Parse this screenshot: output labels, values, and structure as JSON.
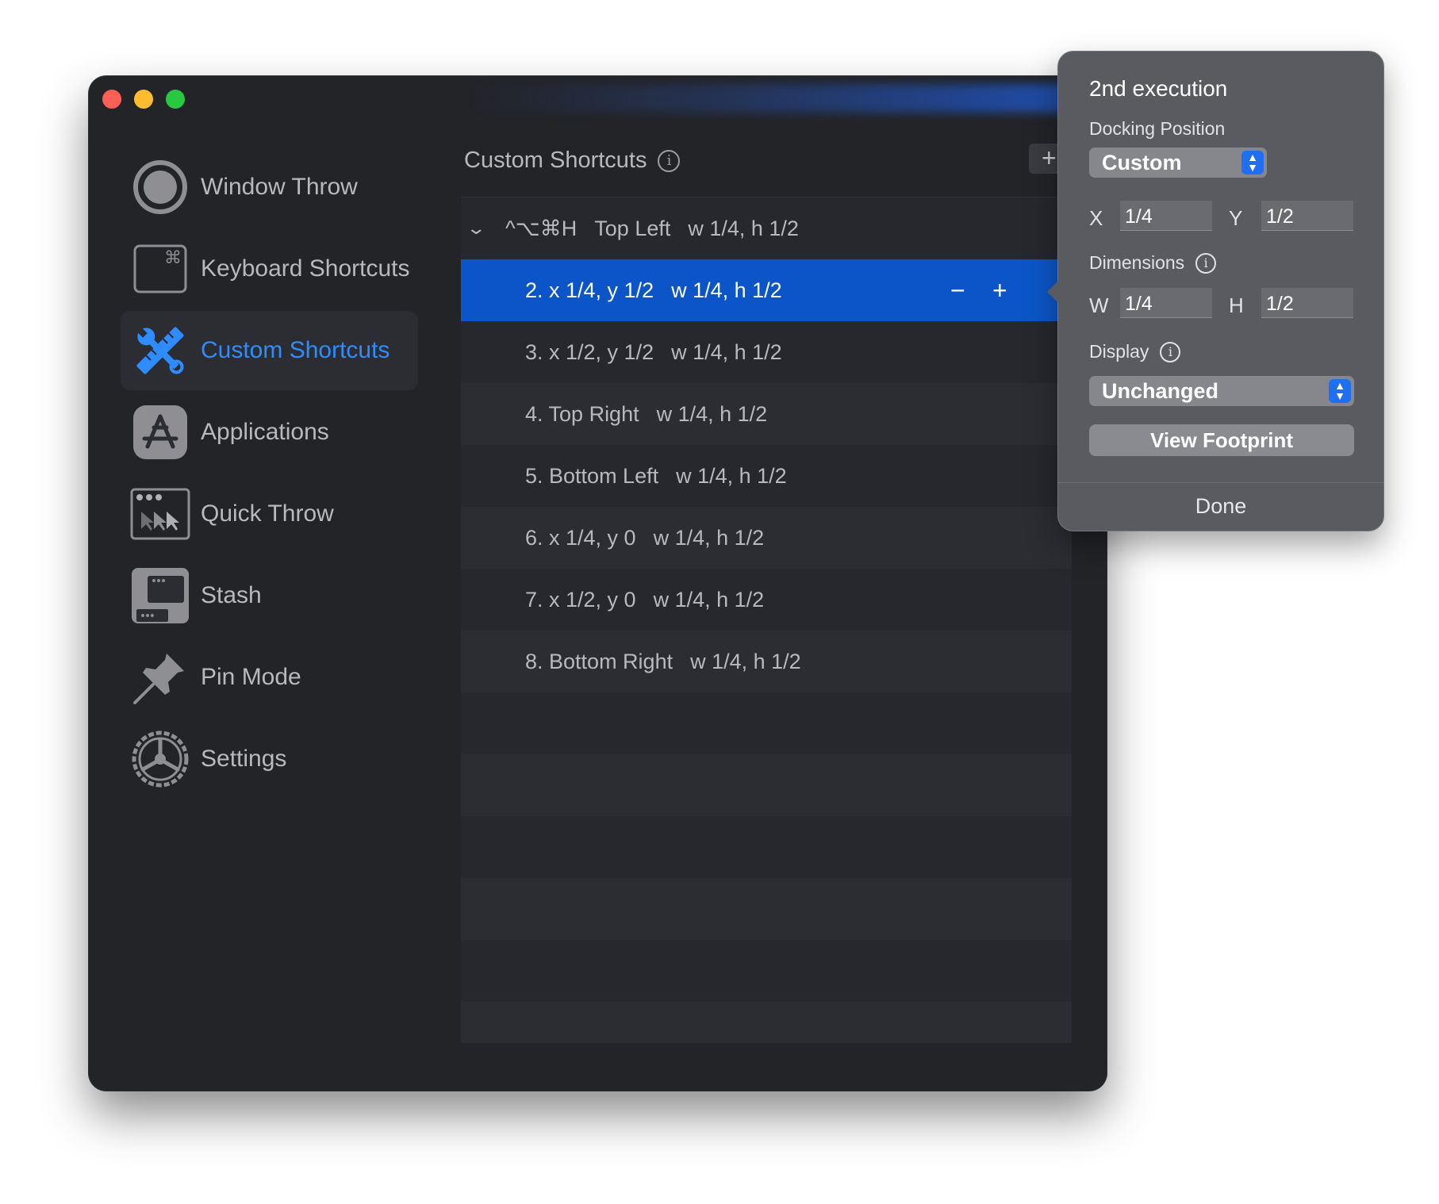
{
  "sidebar": {
    "items": [
      {
        "label": "Window Throw",
        "icon": "window-throw-icon"
      },
      {
        "label": "Keyboard Shortcuts",
        "icon": "command-key-icon"
      },
      {
        "label": "Custom Shortcuts",
        "icon": "wrench-ruler-icon",
        "active": true
      },
      {
        "label": "Applications",
        "icon": "app-store-icon"
      },
      {
        "label": "Quick Throw",
        "icon": "quick-throw-icon"
      },
      {
        "label": "Stash",
        "icon": "stash-icon"
      },
      {
        "label": "Pin Mode",
        "icon": "pushpin-icon"
      },
      {
        "label": "Settings",
        "icon": "gear-icon"
      }
    ]
  },
  "main": {
    "title": "Custom Shortcuts",
    "info": "i",
    "add_label": "+",
    "group": {
      "expand": "⌄",
      "shortcut": "^⌥⌘H",
      "name": "Top Left",
      "size": "w 1/4, h 1/2"
    },
    "rows": [
      {
        "name": "2. x 1/4, y 1/2",
        "size": "w 1/4, h 1/2"
      },
      {
        "name": "3. x 1/2, y 1/2",
        "size": "w 1/4, h 1/2"
      },
      {
        "name": "4. Top Right",
        "size": "w 1/4, h 1/2"
      },
      {
        "name": "5. Bottom Left",
        "size": "w 1/4, h 1/2"
      },
      {
        "name": "6. x 1/4, y 0",
        "size": "w 1/4, h 1/2"
      },
      {
        "name": "7. x 1/2, y 0",
        "size": "w 1/4, h 1/2"
      },
      {
        "name": "8. Bottom Right",
        "size": "w 1/4, h 1/2"
      }
    ],
    "row_remove": "−",
    "row_add": "+"
  },
  "popover": {
    "title": "2nd execution",
    "docking_label": "Docking Position",
    "docking_value": "Custom",
    "x_label": "X",
    "x_value": "1/4",
    "y_label": "Y",
    "y_value": "1/2",
    "dimensions_label": "Dimensions",
    "w_label": "W",
    "w_value": "1/4",
    "h_label": "H",
    "h_value": "1/2",
    "display_label": "Display",
    "display_value": "Unchanged",
    "view_footprint": "View Footprint",
    "done": "Done",
    "info": "i",
    "stepper_up": "▲",
    "stepper_down": "▼"
  },
  "colors": {
    "accent": "#2f8cff",
    "selection": "#0c55c8",
    "window_bg": "#232428",
    "popover_bg": "#5a5b60"
  }
}
